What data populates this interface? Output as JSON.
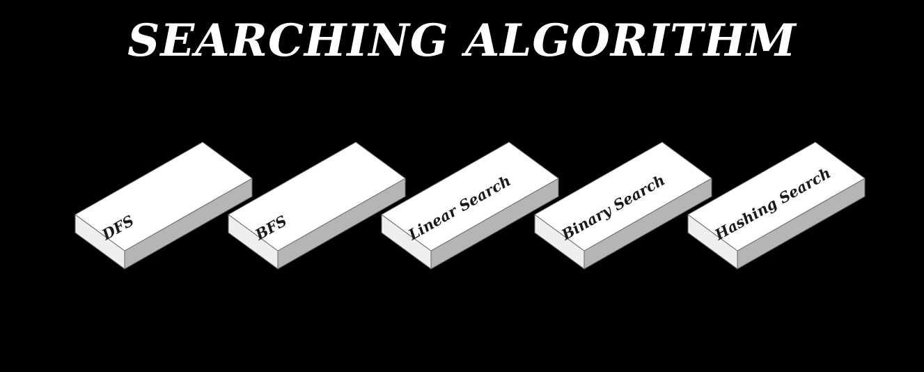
{
  "page": {
    "title": "SEARCHING ALGORITHM"
  },
  "colors": {
    "background": "#000000",
    "title": "#ffffff",
    "block_top": "#ffffff",
    "block_left": "#efefef",
    "block_right": "#b5b5b5",
    "block_edge": "#666666",
    "label": "#1a1a1a"
  },
  "blocks": [
    {
      "label": "DFS"
    },
    {
      "label": "BFS"
    },
    {
      "label": "Linear Search"
    },
    {
      "label": "Binary Search"
    },
    {
      "label": "Hashing Search"
    }
  ]
}
